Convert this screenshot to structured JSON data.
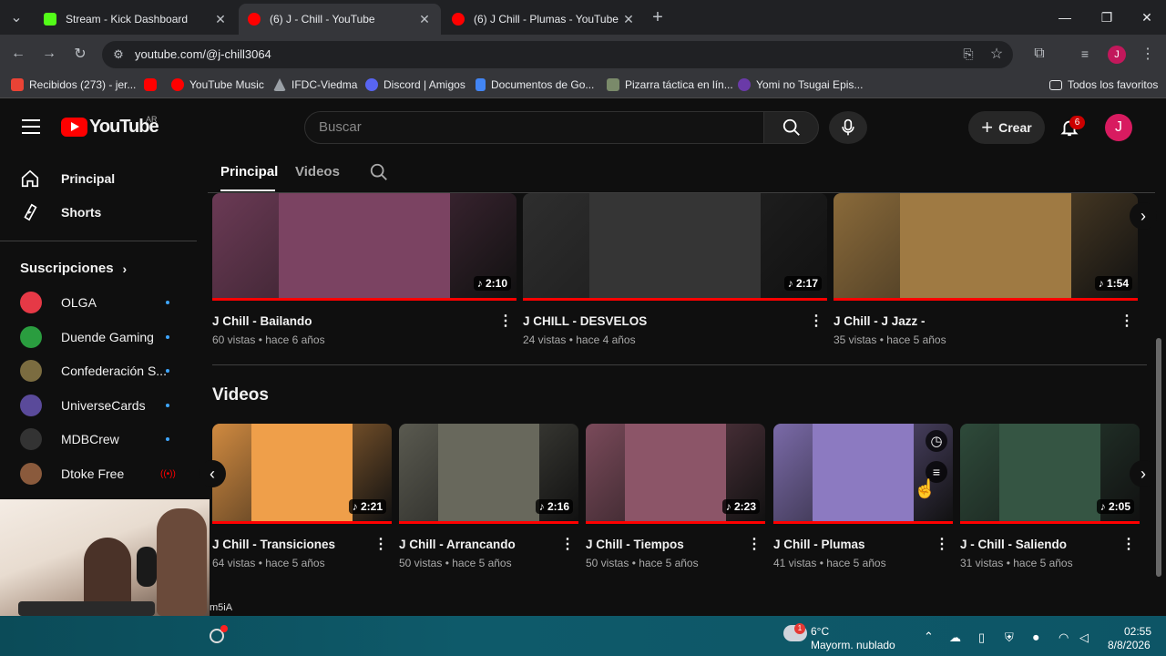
{
  "browser": {
    "tabs": [
      {
        "title": "Stream - Kick Dashboard",
        "color": "#53fc18"
      },
      {
        "title": "(6) J - Chill - YouTube",
        "color": "#ff0000"
      },
      {
        "title": "(6) J Chill - Plumas - YouTube",
        "color": "#ff0000"
      }
    ],
    "url": "youtube.com/@j-chill3064",
    "profile_initial": "J",
    "bookmarks": [
      "Recibidos (273) - jer...",
      "YouTube Music",
      "IFDC-Viedma",
      "Discord | Amigos",
      "Documentos de Go...",
      "Pizarra táctica en lín...",
      "Yomi no Tsugai Epis..."
    ],
    "all_bookmarks": "Todos los favoritos"
  },
  "youtube": {
    "logo_text": "YouTube",
    "logo_region": "AR",
    "search_placeholder": "Buscar",
    "create_label": "Crear",
    "notifications": "6",
    "avatar_initial": "J",
    "channel_tabs": [
      "Principal",
      "Videos"
    ],
    "sidebar": {
      "main": [
        "Principal",
        "Shorts"
      ],
      "subs_heading": "Suscripciones",
      "subs": [
        {
          "name": "OLGA",
          "color": "#e63946",
          "live": false
        },
        {
          "name": "Duende Gaming",
          "color": "#2a9d3f",
          "live": false
        },
        {
          "name": "Confederación S...",
          "color": "#7b6c40",
          "live": false
        },
        {
          "name": "UniverseCards",
          "color": "#5a4a9a",
          "live": false
        },
        {
          "name": "MDBCrew",
          "color": "#333333",
          "live": false
        },
        {
          "name": "Dtoke Free",
          "color": "#8a5a3c",
          "live": true
        }
      ]
    },
    "row1": [
      {
        "title": "J Chill - Bailando",
        "meta": "60 vistas • hace 6 años",
        "duration": "2:10",
        "thumb": "#6b3a55"
      },
      {
        "title": "J CHILL - DESVELOS",
        "meta": "24 vistas • hace 4 años",
        "duration": "2:17",
        "thumb": "#2e2e2e"
      },
      {
        "title": "J Chill - J Jazz -",
        "meta": "35 vistas • hace 5 años",
        "duration": "1:54",
        "thumb": "#8a6a3a"
      }
    ],
    "videos_heading": "Videos",
    "row2": [
      {
        "title": "J Chill - Transiciones",
        "meta": "64 vistas • hace 5 años",
        "duration": "2:21",
        "thumb": "#d08a40"
      },
      {
        "title": "J Chill - Arrancando",
        "meta": "50 vistas • hace 5 años",
        "duration": "2:16",
        "thumb": "#5a5a50"
      },
      {
        "title": "J Chill - Tiempos",
        "meta": "50 vistas • hace 5 años",
        "duration": "2:23",
        "thumb": "#7a4a5a"
      },
      {
        "title": "J Chill - Plumas",
        "meta": "41 vistas • hace 5 años",
        "duration": "",
        "thumb": "#7a6aa8"
      },
      {
        "title": "J - Chill - Saliendo",
        "meta": "31 vistas • hace 5 años",
        "duration": "2:05",
        "thumb": "#2e4a3a"
      }
    ],
    "overlay_text": "m5iA"
  },
  "taskbar": {
    "weather_temp": "6°C",
    "weather_desc": "Mayorm. nublado",
    "weather_badge": "1",
    "time": "02:55",
    "date": "8/8/2026"
  }
}
